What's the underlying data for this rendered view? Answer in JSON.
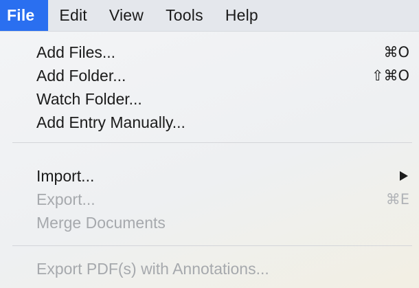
{
  "menubar": {
    "items": [
      {
        "label": "File",
        "active": true
      },
      {
        "label": "Edit"
      },
      {
        "label": "View"
      },
      {
        "label": "Tools"
      },
      {
        "label": "Help"
      }
    ]
  },
  "menu": {
    "items": [
      {
        "label": "Add Files...",
        "shortcut": "⌘O",
        "enabled": true
      },
      {
        "label": "Add Folder...",
        "shortcut": "⇧⌘O",
        "enabled": true
      },
      {
        "label": "Watch Folder...",
        "shortcut": "",
        "enabled": true
      },
      {
        "label": "Add Entry Manually...",
        "shortcut": "",
        "enabled": true
      },
      {
        "label": "Import...",
        "shortcut": "",
        "submenu": true,
        "icon": "submenu-arrow-icon",
        "enabled": true
      },
      {
        "label": "Export...",
        "shortcut": "⌘E",
        "enabled": false
      },
      {
        "label": "Merge Documents",
        "shortcut": "",
        "enabled": false
      },
      {
        "label": "Export PDF(s) with Annotations...",
        "shortcut": "",
        "enabled": false
      }
    ]
  },
  "colors": {
    "accent": "#2a6ff0",
    "text": "#1b1b1b",
    "disabled_text": "#a6a9ad"
  }
}
